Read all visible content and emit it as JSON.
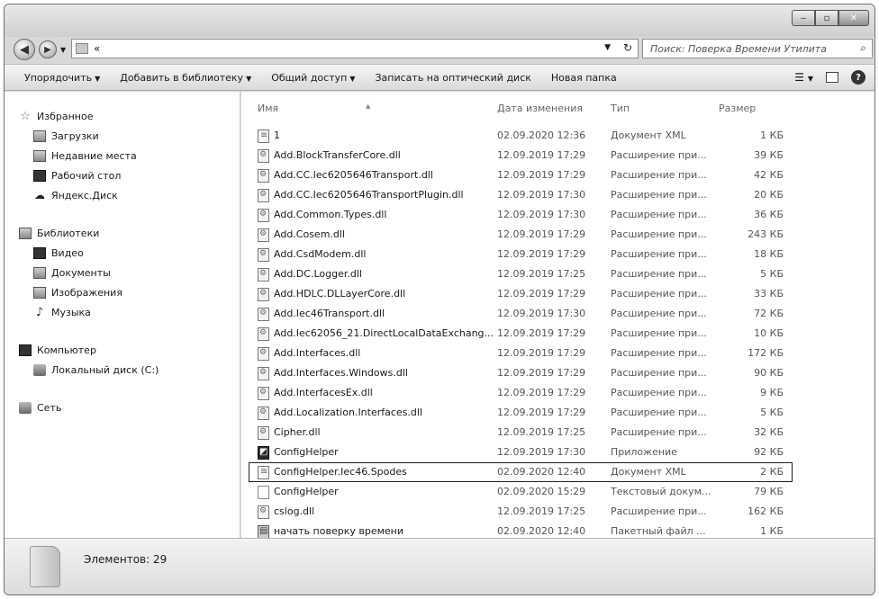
{
  "window": {
    "controls": {
      "minimize": "‒",
      "maximize": "▫",
      "close": "✕"
    }
  },
  "navbar": {
    "back": "◀",
    "forward": "▶",
    "address": "«",
    "search_placeholder": "Поиск: Поверка Времени Утилита"
  },
  "toolbar": {
    "items": [
      {
        "label": "Упорядочить",
        "dropdown": true
      },
      {
        "label": "Добавить в библиотеку",
        "dropdown": true
      },
      {
        "label": "Общий доступ",
        "dropdown": true
      },
      {
        "label": "Записать на оптический диск",
        "dropdown": false
      },
      {
        "label": "Новая папка",
        "dropdown": false
      }
    ],
    "view_icon": "☰",
    "help": "?"
  },
  "sidebar": {
    "groups": [
      {
        "label": "Избранное",
        "icon": "star-icon",
        "items": [
          {
            "label": "Загрузки",
            "icon": "downloads-icon"
          },
          {
            "label": "Недавние места",
            "icon": "recent-places-icon"
          },
          {
            "label": "Рабочий стол",
            "icon": "desktop-icon"
          },
          {
            "label": "Яндекс.Диск",
            "icon": "yandex-disk-icon"
          }
        ]
      },
      {
        "label": "Библиотеки",
        "icon": "libraries-icon",
        "items": [
          {
            "label": "Видео",
            "icon": "video-icon"
          },
          {
            "label": "Документы",
            "icon": "documents-icon"
          },
          {
            "label": "Изображения",
            "icon": "images-icon"
          },
          {
            "label": "Музыка",
            "icon": "music-icon"
          }
        ]
      },
      {
        "label": "Компьютер",
        "icon": "computer-icon",
        "items": [
          {
            "label": "Локальный диск (C:)",
            "icon": "local-disk-icon"
          }
        ]
      },
      {
        "label": "Сеть",
        "icon": "network-icon",
        "items": []
      }
    ]
  },
  "file_list": {
    "columns": {
      "name": "Имя",
      "date": "Дата изменения",
      "type": "Тип",
      "size": "Размер"
    },
    "rows": [
      {
        "name": "1",
        "date": "02.09.2020 12:36",
        "type": "Документ XML",
        "size": "1 КБ",
        "icon": "xml"
      },
      {
        "name": "Add.BlockTransferCore.dll",
        "date": "12.09.2019 17:29",
        "type": "Расширение при...",
        "size": "39 КБ",
        "icon": "dll"
      },
      {
        "name": "Add.CC.Iec6205646Transport.dll",
        "date": "12.09.2019 17:29",
        "type": "Расширение при...",
        "size": "42 КБ",
        "icon": "dll"
      },
      {
        "name": "Add.CC.Iec6205646TransportPlugin.dll",
        "date": "12.09.2019 17:30",
        "type": "Расширение при...",
        "size": "20 КБ",
        "icon": "dll"
      },
      {
        "name": "Add.Common.Types.dll",
        "date": "12.09.2019 17:30",
        "type": "Расширение при...",
        "size": "36 КБ",
        "icon": "dll"
      },
      {
        "name": "Add.Cosem.dll",
        "date": "12.09.2019 17:29",
        "type": "Расширение при...",
        "size": "243 КБ",
        "icon": "dll"
      },
      {
        "name": "Add.CsdModem.dll",
        "date": "12.09.2019 17:29",
        "type": "Расширение при...",
        "size": "18 КБ",
        "icon": "dll"
      },
      {
        "name": "Add.DC.Logger.dll",
        "date": "12.09.2019 17:25",
        "type": "Расширение при...",
        "size": "5 КБ",
        "icon": "dll"
      },
      {
        "name": "Add.HDLC.DLLayerCore.dll",
        "date": "12.09.2019 17:29",
        "type": "Расширение при...",
        "size": "33 КБ",
        "icon": "dll"
      },
      {
        "name": "Add.Iec46Transport.dll",
        "date": "12.09.2019 17:30",
        "type": "Расширение при...",
        "size": "72 КБ",
        "icon": "dll"
      },
      {
        "name": "Add.Iec62056_21.DirectLocalDataExchang...",
        "date": "12.09.2019 17:29",
        "type": "Расширение при...",
        "size": "10 КБ",
        "icon": "dll"
      },
      {
        "name": "Add.Interfaces.dll",
        "date": "12.09.2019 17:29",
        "type": "Расширение при...",
        "size": "172 КБ",
        "icon": "dll"
      },
      {
        "name": "Add.Interfaces.Windows.dll",
        "date": "12.09.2019 17:29",
        "type": "Расширение при...",
        "size": "90 КБ",
        "icon": "dll"
      },
      {
        "name": "Add.InterfacesEx.dll",
        "date": "12.09.2019 17:29",
        "type": "Расширение при...",
        "size": "9 КБ",
        "icon": "dll"
      },
      {
        "name": "Add.Localization.Interfaces.dll",
        "date": "12.09.2019 17:29",
        "type": "Расширение при...",
        "size": "5 КБ",
        "icon": "dll"
      },
      {
        "name": "Cipher.dll",
        "date": "12.09.2019 17:25",
        "type": "Расширение при...",
        "size": "32 КБ",
        "icon": "dll"
      },
      {
        "name": "ConfigHelper",
        "date": "12.09.2019 17:30",
        "type": "Приложение",
        "size": "92 КБ",
        "icon": "exe"
      },
      {
        "name": "ConfigHelper.Iec46.Spodes",
        "date": "02.09.2020 12:40",
        "type": "Документ XML",
        "size": "2 КБ",
        "icon": "xml",
        "selected": true
      },
      {
        "name": "ConfigHelper",
        "date": "02.09.2020 15:29",
        "type": "Текстовый докум...",
        "size": "79 КБ",
        "icon": "txt"
      },
      {
        "name": "cslog.dll",
        "date": "12.09.2019 17:25",
        "type": "Расширение при...",
        "size": "162 КБ",
        "icon": "dll"
      },
      {
        "name": "начать поверку времени",
        "date": "02.09.2020 12:40",
        "type": "Пакетный файл ...",
        "size": "1 КБ",
        "icon": "bat"
      }
    ]
  },
  "status": {
    "text": "Элементов: 29"
  }
}
